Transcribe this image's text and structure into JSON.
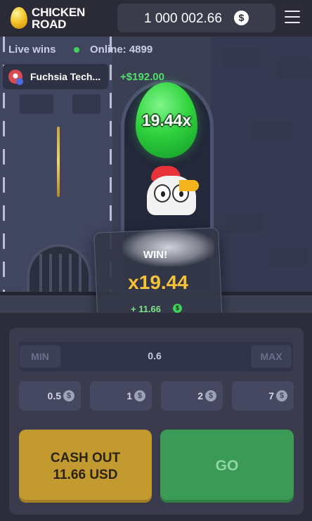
{
  "header": {
    "logo_line1": "CHICKEN",
    "logo_line2": "ROAD",
    "balance": "1 000 002.66",
    "currency_symbol": "$"
  },
  "live": {
    "live_wins_label": "Live wins",
    "online_label": "Online: 4899",
    "recent_win": {
      "user": "Fuchsia Tech...",
      "amount": "+$192.00"
    }
  },
  "scene": {
    "egg_multiplier": "19.44x"
  },
  "win_popup": {
    "title": "WIN!",
    "multiplier": "x19.44",
    "gain": "+ 11.66",
    "currency_symbol": "$"
  },
  "controls": {
    "min_label": "MIN",
    "max_label": "MAX",
    "bet_value": "0.6",
    "quick_bets": [
      {
        "value": "0.5",
        "symbol": "$"
      },
      {
        "value": "1",
        "symbol": "$"
      },
      {
        "value": "2",
        "symbol": "$"
      },
      {
        "value": "7",
        "symbol": "$"
      }
    ],
    "cashout_line1": "CASH OUT",
    "cashout_line2": "11.66 USD",
    "go_label": "GO"
  },
  "colors": {
    "accent_gold": "#c29a2f",
    "go_green": "#3b9a55",
    "win_green": "#4fe067",
    "multiplier_gold": "#f5c23a"
  }
}
